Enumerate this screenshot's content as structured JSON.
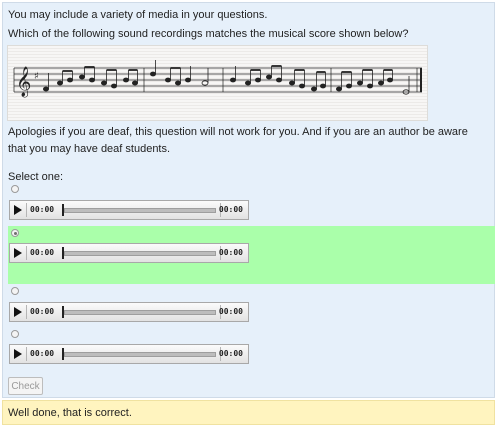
{
  "question": {
    "intro": "You may include a variety of media in your questions.",
    "prompt": "Which of the following sound recordings matches the musical score shown below?",
    "apology": "Apologies if you are deaf, this question will not work for you. And if you are an author be aware that you may have deaf students.",
    "select_label": "Select one:"
  },
  "score_image": {
    "icon": "musical-score-icon"
  },
  "options": [
    {
      "current": "00:00",
      "duration": "00:00",
      "selected": false
    },
    {
      "current": "00:00",
      "duration": "00:00",
      "selected": true
    },
    {
      "current": "00:00",
      "duration": "00:00",
      "selected": false
    },
    {
      "current": "00:00",
      "duration": "00:00",
      "selected": false
    }
  ],
  "check_button": "Check",
  "feedback": "Well done, that is correct.",
  "colors": {
    "question_bg": "#e6f0fa",
    "correct_bg": "#aaffaa",
    "feedback_bg": "#fff4bf"
  }
}
